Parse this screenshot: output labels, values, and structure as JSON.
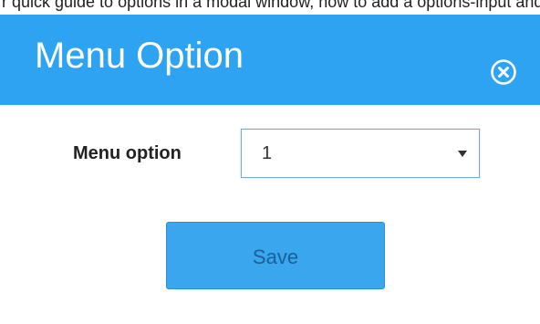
{
  "intro": {
    "text": "r quick guide to options in a modal window, how to add a options-input and validation to the modal"
  },
  "dialog": {
    "title": "Menu Option",
    "close_icon": "close-circle-icon",
    "field": {
      "label": "Menu option",
      "value": "1",
      "arrow_icon": "chevron-down-icon"
    },
    "save_label": "Save"
  },
  "colors": {
    "header_bg": "#2ea3f2",
    "button_bg": "#39a6ee",
    "button_text": "#1b5f9a",
    "select_border": "#7aa8d6"
  }
}
